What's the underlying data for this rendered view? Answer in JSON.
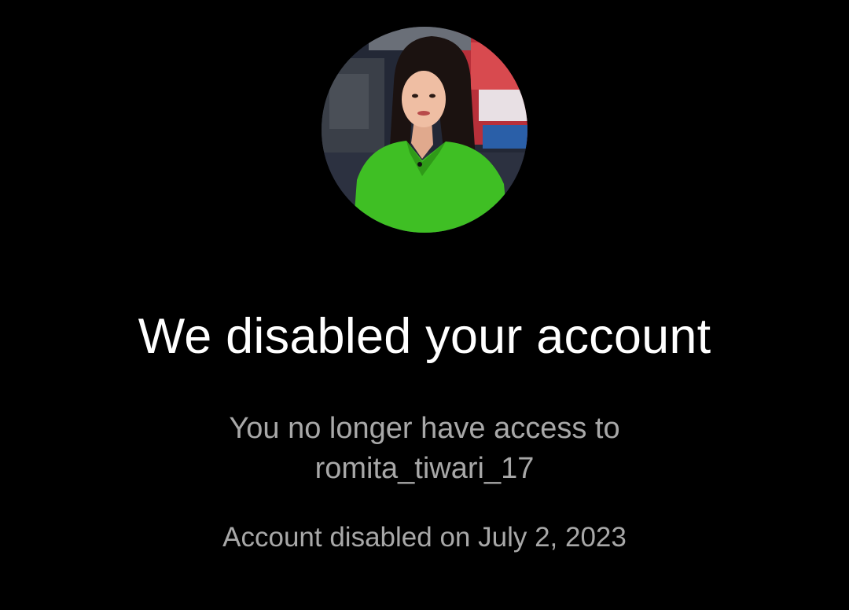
{
  "profile": {
    "avatar_icon": "profile-photo"
  },
  "notice": {
    "title": "We disabled your account",
    "message_line1": "You no longer have access to",
    "username": "romita_tiwari_17",
    "disabled_date_text": "Account disabled on July 2, 2023"
  },
  "colors": {
    "background": "#000000",
    "title": "#ffffff",
    "secondary_text": "#a8a8a8"
  }
}
